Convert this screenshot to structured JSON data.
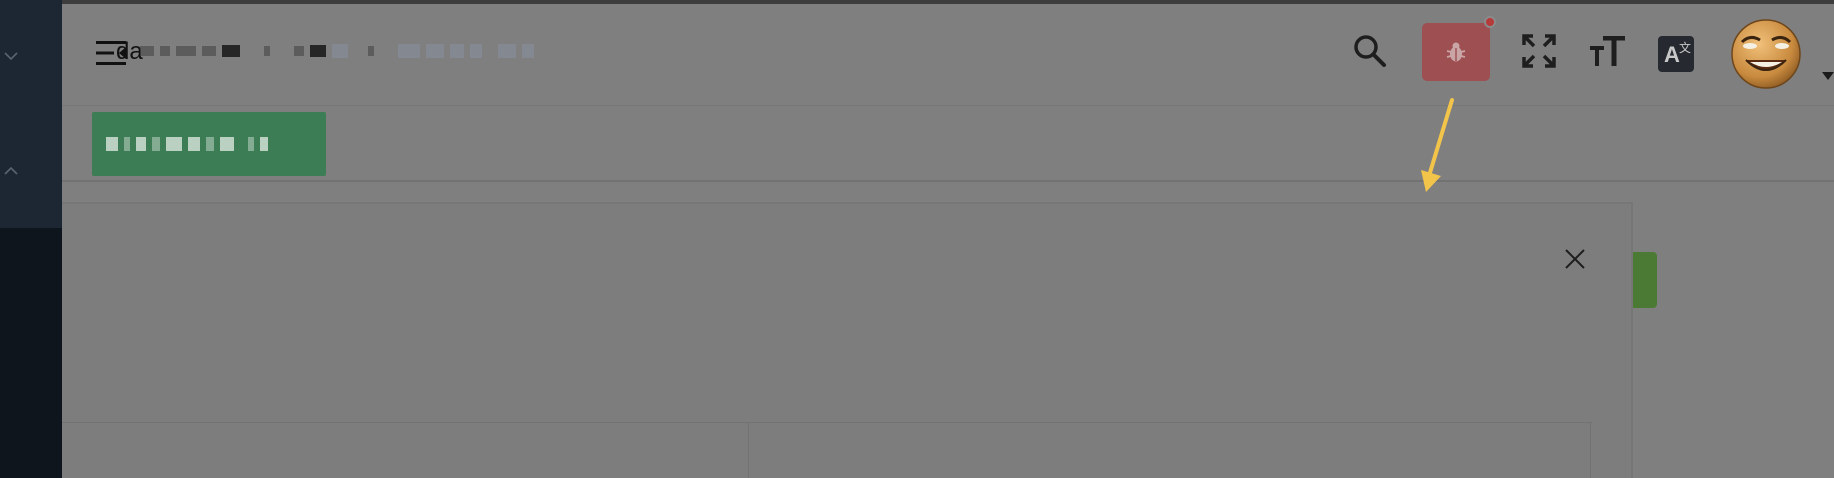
{
  "header": {
    "title_prefix": "da"
  },
  "icons": {
    "menu": "menu-fold-icon",
    "search": "search-icon",
    "bug": "bug-icon",
    "fullscreen": "fullscreen-icon",
    "font_size": "font-size-icon",
    "translate": "translate-icon",
    "translate_main": "A",
    "translate_sub": "文",
    "avatar": "avatar"
  },
  "colors": {
    "sidebar": "#0f151d",
    "overlay": "#7f7f7f",
    "bug_button": "#9e4f52",
    "tag": "#3c7d55",
    "arrow": "#f3c44a",
    "green_button": "#4a7a34"
  }
}
